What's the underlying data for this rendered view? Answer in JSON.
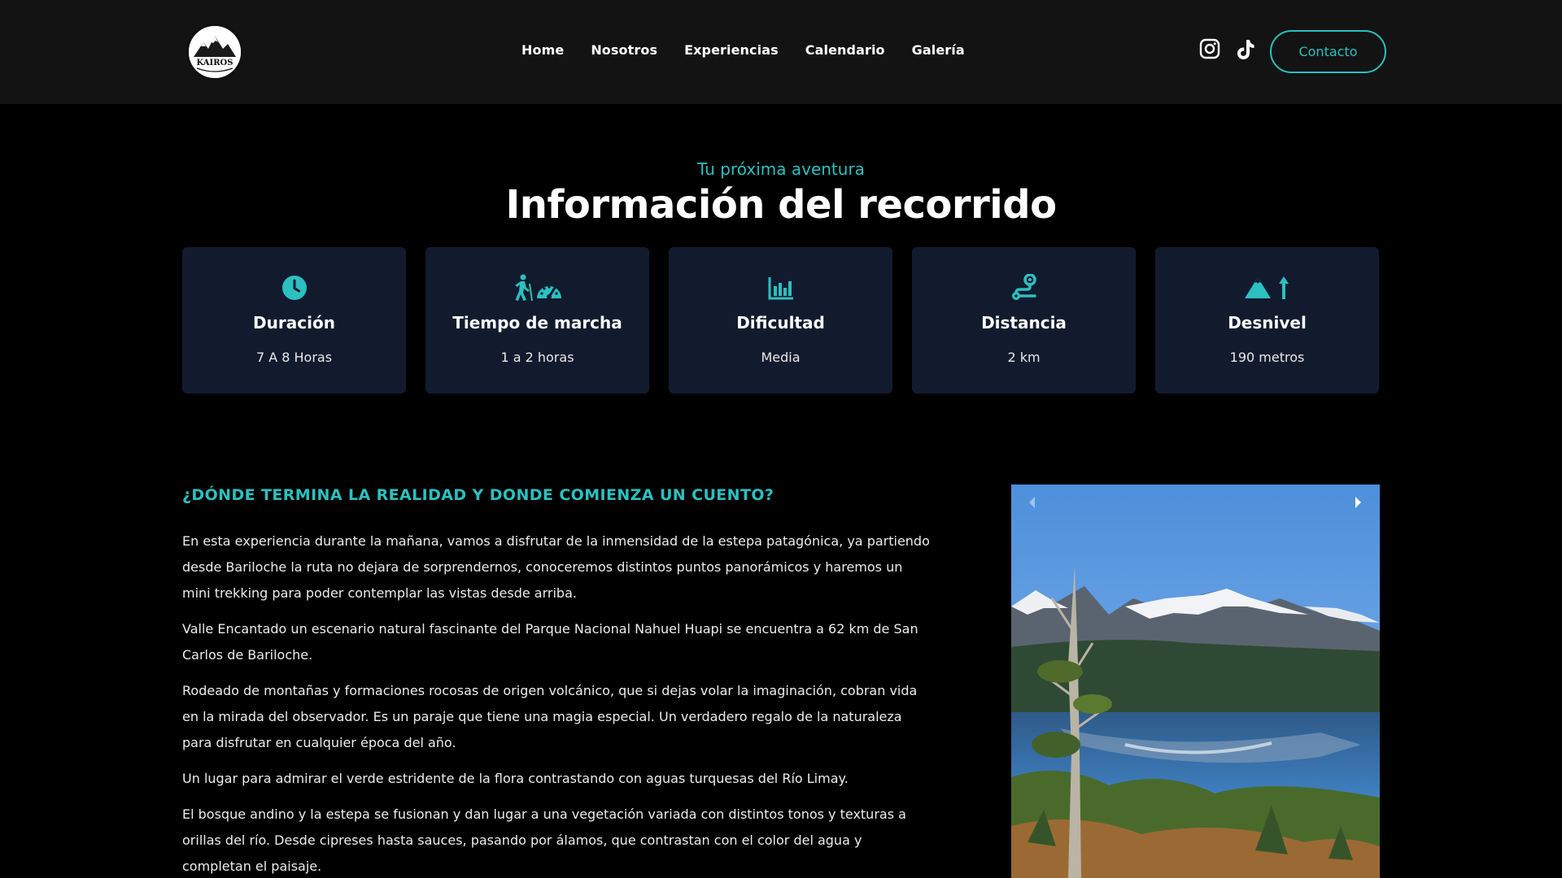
{
  "header": {
    "logo_text": "KAIROS",
    "nav": [
      "Home",
      "Nosotros",
      "Experiencias",
      "Calendario",
      "Galería"
    ],
    "contact_label": "Contacto",
    "social_icons": [
      "instagram-icon",
      "tiktok-icon"
    ]
  },
  "hero": {
    "eyebrow": "Tu próxima aventura",
    "title": "Información del recorrido"
  },
  "cards": [
    {
      "icon": "clock-icon",
      "title": "Duración",
      "value": "7 A 8 Horas"
    },
    {
      "icon": "hiker-gauge-icon",
      "title": "Tiempo de marcha",
      "value": "1 a 2 horas"
    },
    {
      "icon": "bar-chart-icon",
      "title": "Dificultad",
      "value": "Media"
    },
    {
      "icon": "route-icon",
      "title": "Distancia",
      "value": "2 km"
    },
    {
      "icon": "mountain-up-icon",
      "title": "Desnivel",
      "value": "190 metros"
    }
  ],
  "content": {
    "heading": "¿DÓNDE TERMINA LA REALIDAD Y DONDE COMIENZA UN CUENTO?",
    "paragraphs": [
      "En esta experiencia durante la mañana, vamos a disfrutar de la inmensidad de la estepa patagónica, ya partiendo desde Bariloche la ruta no dejara de sorprendernos, conoceremos distintos puntos panorámicos y haremos un mini trekking para poder contemplar las vistas desde arriba.",
      "Valle Encantado un escenario natural fascinante del Parque Nacional Nahuel Huapi se encuentra a 62 km de San Carlos de Bariloche.",
      "Rodeado de montañas y formaciones rocosas de origen volcánico, que si dejas volar la imaginación, cobran vida en la mirada del observador. Es un paraje que tiene una magia especial. Un verdadero regalo de la naturaleza para disfrutar en cualquier época del año.",
      "Un lugar para admirar el verde estridente de la flora contrastando con aguas turquesas del Río Limay.",
      "El bosque andino y la estepa se fusionan y dan lugar a una vegetación variada con distintos tonos y texturas a orillas del río. Desde cipreses hasta sauces, pasando por álamos, que contrastan con el color del agua y completan el paisaje."
    ]
  },
  "colors": {
    "accent": "#2cc0c0",
    "header_bg": "#131313",
    "card_bg": "#121b2e",
    "page_bg": "#000000"
  }
}
